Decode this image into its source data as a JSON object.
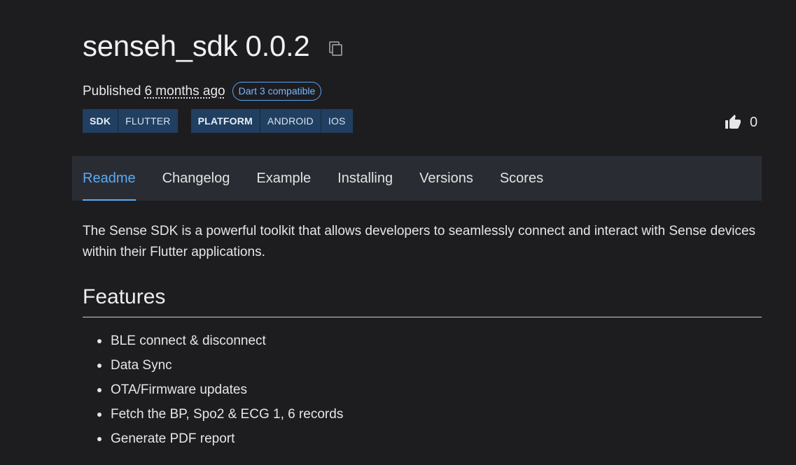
{
  "package": {
    "title": "senseh_sdk 0.0.2",
    "published_label": "Published",
    "published_time": "6 months ago",
    "compat_badge": "Dart 3 compatible"
  },
  "tags": {
    "group1": [
      "SDK",
      "FLUTTER"
    ],
    "group2": [
      "PLATFORM",
      "ANDROID",
      "IOS"
    ]
  },
  "likes": {
    "count": "0",
    "icon": "thumbs-up-icon"
  },
  "tabs": [
    {
      "label": "Readme",
      "active": true
    },
    {
      "label": "Changelog"
    },
    {
      "label": "Example"
    },
    {
      "label": "Installing"
    },
    {
      "label": "Versions"
    },
    {
      "label": "Scores"
    }
  ],
  "readme": {
    "description": "The Sense SDK is a powerful toolkit that allows developers to seamlessly connect and interact with Sense devices within their Flutter applications.",
    "features_heading": "Features",
    "features": [
      "BLE connect & disconnect",
      "Data Sync",
      "OTA/Firmware updates",
      "Fetch the BP, Spo2 & ECG 1, 6 records",
      "Generate PDF report"
    ]
  },
  "colors": {
    "background": "#1d1d20",
    "accent": "#5aaaf8",
    "tag_bg": "#203f61",
    "tabs_bg": "#292d33"
  }
}
